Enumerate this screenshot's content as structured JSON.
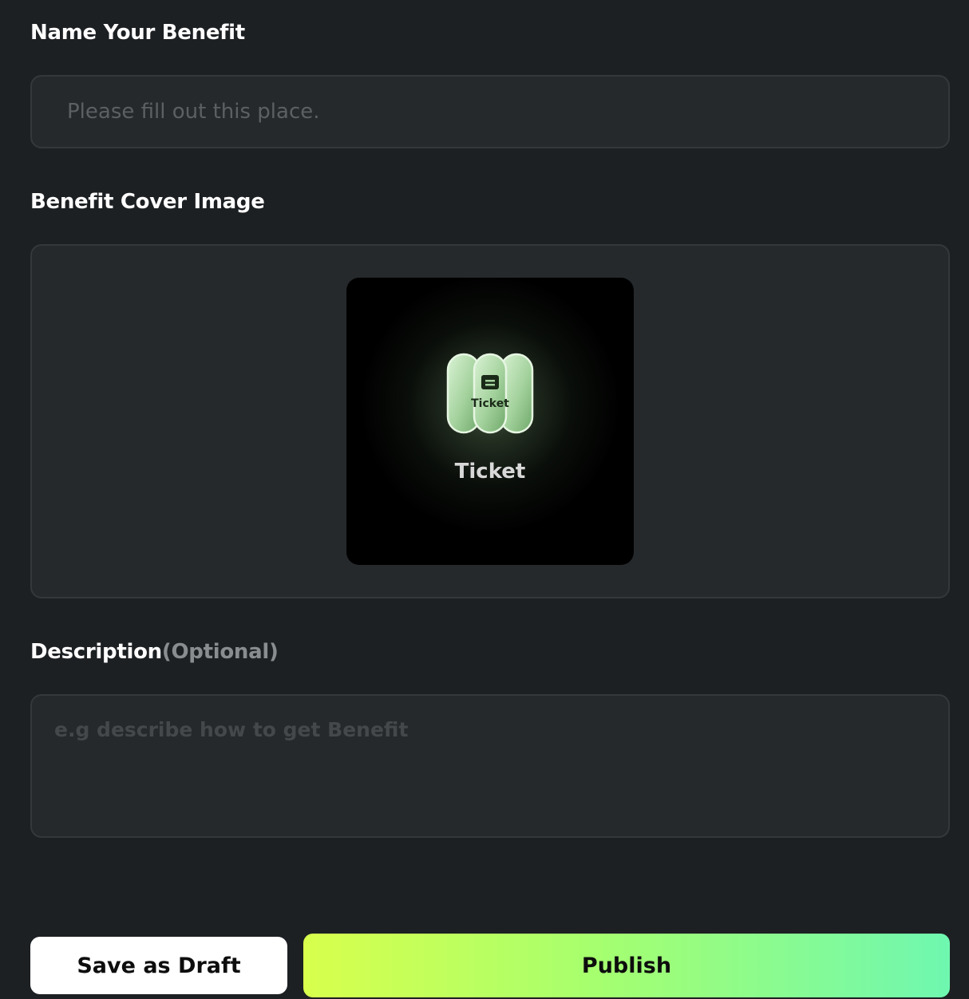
{
  "name_section": {
    "label": "Name Your Benefit",
    "placeholder": "Please fill out this place.",
    "value": ""
  },
  "cover_section": {
    "label": "Benefit Cover Image",
    "image": {
      "icon": "ticket-icon",
      "badge_text": "Ticket",
      "caption": "Ticket",
      "accent_color": "#a9d6a4"
    }
  },
  "description_section": {
    "label": "Description",
    "optional_label": "(Optional)",
    "placeholder": "e.g describe how to get Benefit",
    "value": ""
  },
  "actions": {
    "draft_label": "Save as Draft",
    "publish_label": "Publish"
  },
  "colors": {
    "background": "#1d2023",
    "field_background": "#25292c",
    "publish_gradient_start": "#d8ff4c",
    "publish_gradient_end": "#6ff7b0"
  }
}
